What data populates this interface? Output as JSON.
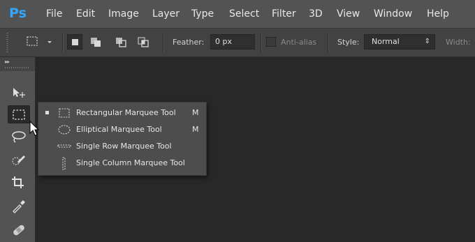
{
  "app": {
    "logo": "Ps",
    "brand_color": "#31a8ff"
  },
  "menu": [
    "File",
    "Edit",
    "Image",
    "Layer",
    "Type",
    "Select",
    "Filter",
    "3D",
    "View",
    "Window",
    "Help"
  ],
  "options_bar": {
    "feather_label": "Feather:",
    "feather_value": "0 px",
    "antialias_label": "Anti-alias",
    "antialias_checked": false,
    "style_label": "Style:",
    "style_value": "Normal",
    "width_label": "Width:"
  },
  "tools": [
    {
      "icon": "move-tool-icon",
      "selected": false
    },
    {
      "icon": "marquee-tool-icon",
      "selected": true
    },
    {
      "icon": "lasso-tool-icon",
      "selected": false
    },
    {
      "icon": "quick-selection-tool-icon",
      "selected": false
    },
    {
      "icon": "crop-tool-icon",
      "selected": false
    },
    {
      "icon": "eyedropper-tool-icon",
      "selected": false
    },
    {
      "icon": "healing-brush-tool-icon",
      "selected": false
    }
  ],
  "flyout": [
    {
      "label": "Rectangular Marquee Tool",
      "shortcut": "M",
      "active": true,
      "icon": "rectangular-marquee-icon"
    },
    {
      "label": "Elliptical Marquee Tool",
      "shortcut": "M",
      "active": false,
      "icon": "elliptical-marquee-icon"
    },
    {
      "label": "Single Row Marquee Tool",
      "shortcut": "",
      "active": false,
      "icon": "single-row-marquee-icon"
    },
    {
      "label": "Single Column Marquee Tool",
      "shortcut": "",
      "active": false,
      "icon": "single-column-marquee-icon"
    }
  ]
}
